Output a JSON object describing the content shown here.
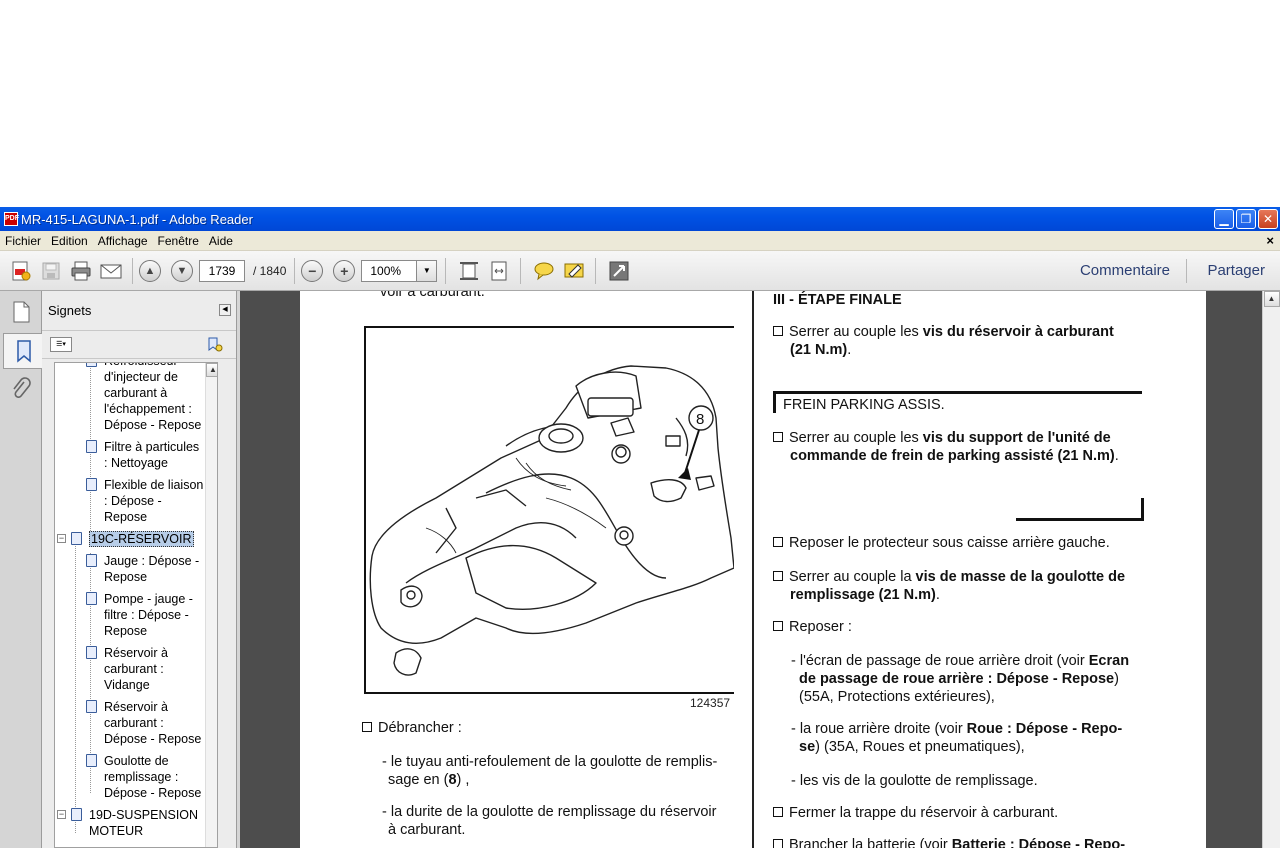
{
  "window": {
    "title": "MR-415-LAGUNA-1.pdf - Adobe Reader",
    "app_icon": "pdf-icon",
    "controls": [
      "minimize-icon",
      "restore-icon",
      "close-icon"
    ]
  },
  "menu": {
    "items": [
      "Fichier",
      "Edition",
      "Affichage",
      "Fenêtre",
      "Aide"
    ],
    "doc_close": "×"
  },
  "toolbar": {
    "page_current": "1739",
    "page_total": "/ 1840",
    "zoom": "100%",
    "comment_label": "Commentaire",
    "share_label": "Partager"
  },
  "bookmarks": {
    "title": "Signets",
    "items": [
      {
        "label": "Refroidisseur d'injecteur de carburant à l'échappement : Dépose - Repose"
      },
      {
        "label": "Filtre à particules : Nettoyage"
      },
      {
        "label": "Flexible de liaison : Dépose - Repose"
      },
      {
        "label": "19C-RÉSERVOIR"
      },
      {
        "label": "Jauge : Dépose - Repose"
      },
      {
        "label": "Pompe - jauge - filtre : Dépose - Repose"
      },
      {
        "label": "Réservoir à carburant : Vidange"
      },
      {
        "label": "Réservoir à carburant : Dépose - Repose"
      },
      {
        "label": "Goulotte de remplissage : Dépose - Repose"
      },
      {
        "label": "19D-SUSPENSION MOTEUR"
      }
    ]
  },
  "document": {
    "left": {
      "top_fragment": "voir à carburant.",
      "callout": "8",
      "figure_number": "124357",
      "step_debrancher": "Débrancher :",
      "item1_pre": "- le tuyau anti-refoulement de la goulotte de remplis-",
      "item1_post_a": "sage en (",
      "item1_bold": "8",
      "item1_post_b": ") ,",
      "item2_a": "- la durite de la goulotte de remplissage du réservoir",
      "item2_b": "à carburant."
    },
    "right": {
      "heading": "III - ÉTAPE FINALE",
      "s1_pre": "Serrer au couple les ",
      "s1_bold": "vis du réservoir à carburant",
      "s1_bold2": "(21 N.m)",
      "s1_post": ".",
      "section_label": "FREIN PARKING ASSIS.",
      "s2_pre": "Serrer au couple les ",
      "s2_bold": "vis du support de l'unité de",
      "s2_bold2": "commande de frein de parking assisté (21 N.m)",
      "s2_post": ".",
      "s3": "Reposer le protecteur sous caisse arrière gauche.",
      "s4_pre": "Serrer au couple la ",
      "s4_bold": "vis de masse de la goulotte de",
      "s4_bold2": "remplissage (21 N.m)",
      "s4_post": ".",
      "s5": "Reposer :",
      "r1_pre": "- l'écran de passage de roue arrière droit (voir ",
      "r1_bold": "Ecran",
      "r1_bold2": "de passage de roue arrière : Dépose - Repose",
      "r1_post": ")",
      "r1_line3": "(55A, Protections extérieures),",
      "r2_pre": "- la roue arrière droite (voir ",
      "r2_bold": "Roue : Dépose - Repo-",
      "r2_bold2": "se",
      "r2_post": ") (35A, Roues et pneumatiques),",
      "r3": "- les vis de la goulotte de remplissage.",
      "s6": "Fermer la trappe du réservoir à carburant.",
      "s7_pre": "Brancher la batterie (voir ",
      "s7_bold": "Batterie : Dépose - Repo-"
    }
  }
}
